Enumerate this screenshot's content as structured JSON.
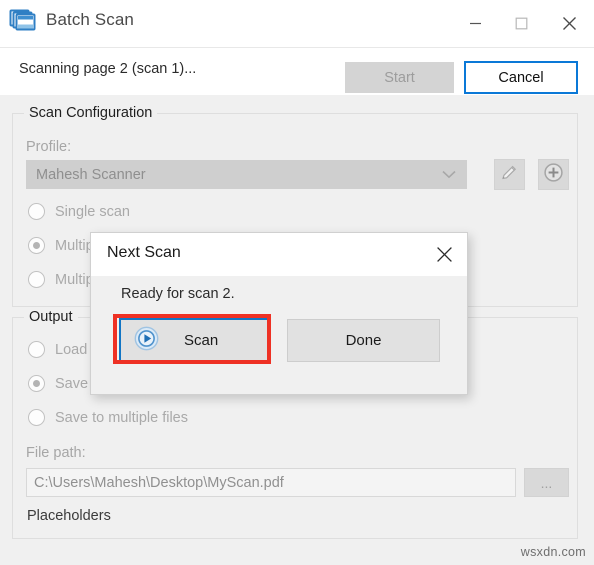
{
  "window": {
    "title": "Batch Scan",
    "icon": "stacked-windows-icon",
    "minimize_label": "–",
    "maximize_label": "□",
    "close_label": "×"
  },
  "status": {
    "text": "Scanning page 2 (scan 1)..."
  },
  "toolbar": {
    "start_label": "Start",
    "start_enabled": false,
    "cancel_label": "Cancel",
    "cancel_focused": true
  },
  "scan_configuration": {
    "legend": "Scan Configuration",
    "profile_label": "Profile:",
    "profile_value": "Mahesh Scanner",
    "edit_profile_icon": "pencil-icon",
    "add_profile_icon": "plus-circle-icon",
    "modes": [
      {
        "label": "Single scan",
        "checked": false
      },
      {
        "label": "Multiple scans, prompt for next page",
        "checked": true
      },
      {
        "label": "Multiple scans, scan until empty",
        "checked": false
      }
    ]
  },
  "output": {
    "legend": "Output",
    "options": [
      {
        "label": "Load into the main window",
        "checked": false
      },
      {
        "label": "Save to a single file",
        "checked": true
      },
      {
        "label": "Save to multiple files",
        "checked": false
      }
    ],
    "file_path_label": "File path:",
    "file_path_value": "C:\\Users\\Mahesh\\Desktop\\MyScan.pdf",
    "browse_label": "...",
    "placeholders_label": "Placeholders"
  },
  "dialog": {
    "title": "Next Scan",
    "close_label": "×",
    "message": "Ready for scan 2.",
    "scan_button_label": "Scan",
    "scan_button_icon": "play-circle-icon",
    "done_button_label": "Done"
  },
  "annotation": {
    "highlight_color": "#ee3124",
    "focus_color": "#0a78d7"
  },
  "watermark": {
    "text": "wsxdn.com"
  }
}
